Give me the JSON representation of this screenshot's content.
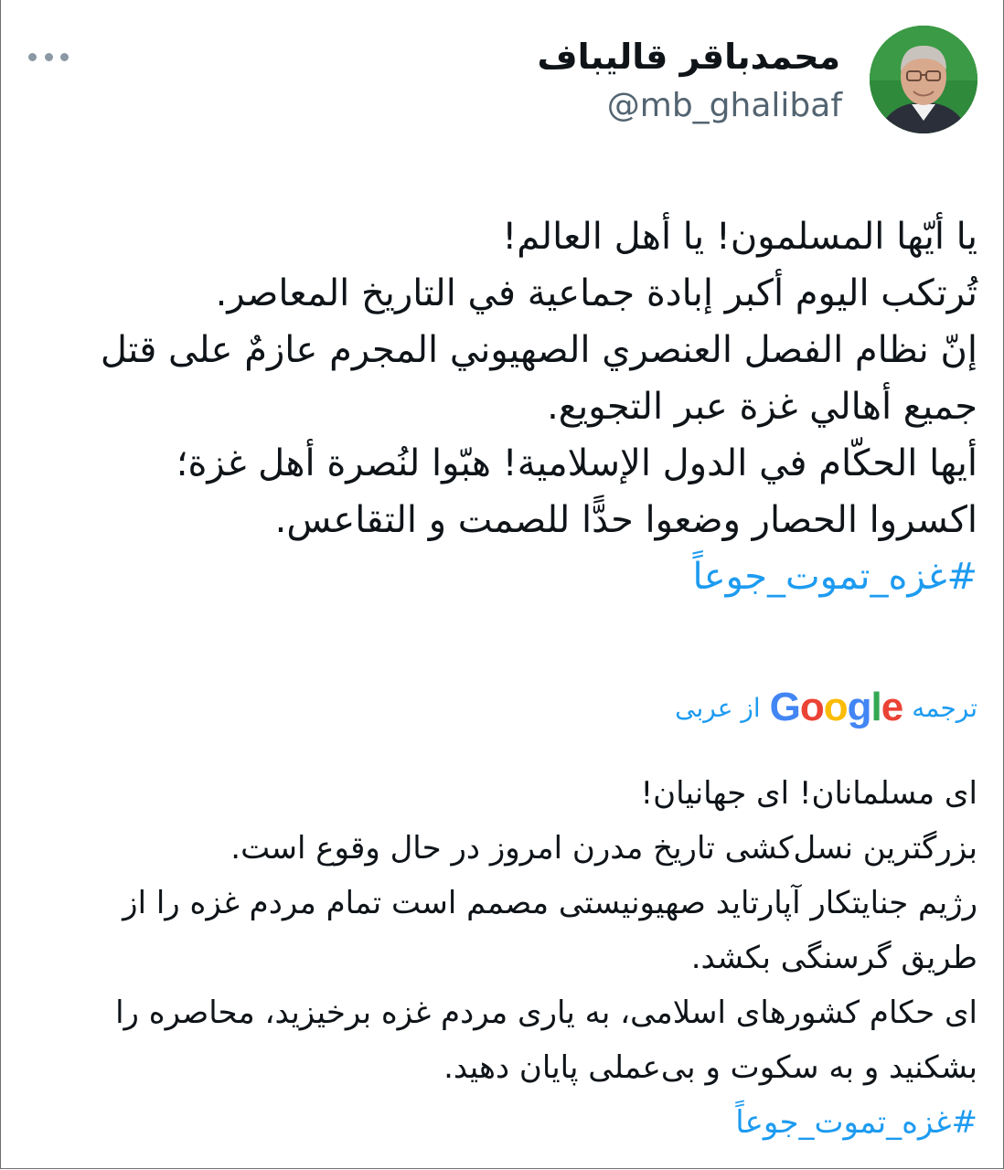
{
  "profile": {
    "display_name": "محمدباقر قالیباف",
    "handle": "@mb_ghalibaf",
    "avatar_icon": "profile-photo",
    "more_icon": "more-horizontal-icon"
  },
  "tweet": {
    "arabic_lines": [
      "يا أيّها المسلمون! يا أهل العالم!",
      "تُرتكب اليوم أكبر إبادة جماعية في التاريخ المعاصر.",
      "إنّ نظام الفصل العنصري الصهيوني المجرم عازمٌ على قتل",
      "جميع أهالي غزة عبر التجويع.",
      "أيها الحكّام في الدول الإسلامية! هبّوا لنُصرة أهل غزة؛",
      "اكسروا الحصار وضعوا حدًّا للصمت و التقاعس."
    ],
    "arabic_hashtag": "#غزه_تموت_جوعاً"
  },
  "translation": {
    "prefix": "ترجمه",
    "google_letters": [
      "G",
      "o",
      "o",
      "g",
      "l",
      "e"
    ],
    "suffix": "از عربی",
    "persian_lines": [
      "ای مسلمانان! ای جهانیان!",
      "بزرگترین نسل‌کشی تاریخ مدرن امروز در حال وقوع است.",
      "رژیم جنایتکار آپارتاید صهیونیستی مصمم است تمام مردم غزه را از",
      "طریق گرسنگی بکشد.",
      "ای حکام کشورهای اسلامی، به یاری مردم غزه برخیزید، محاصره را",
      "بشکنید و به سکوت و بی‌عملی پایان دهید."
    ],
    "persian_hashtag": "#غزه_تموت_جوعاً"
  },
  "colors": {
    "link": "#1d9bf0",
    "secondary_text": "#536471",
    "primary_text": "#0f1419"
  }
}
